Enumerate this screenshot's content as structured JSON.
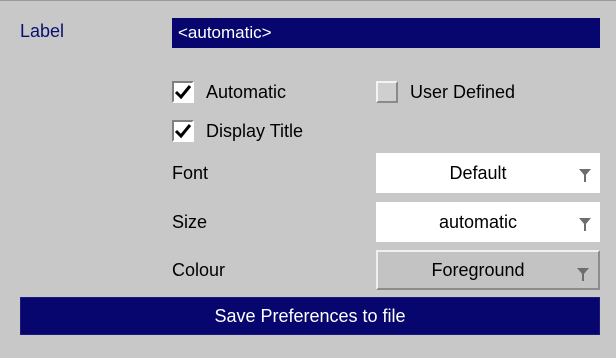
{
  "label": {
    "caption": "Label",
    "value": "<automatic>"
  },
  "checkboxes": {
    "automatic": {
      "label": "Automatic",
      "checked": true
    },
    "user_defined": {
      "label": "User Defined",
      "checked": false
    },
    "display_title": {
      "label": "Display Title",
      "checked": true
    }
  },
  "font": {
    "label": "Font",
    "value": "Default"
  },
  "size": {
    "label": "Size",
    "value": "automatic"
  },
  "colour": {
    "label": "Colour",
    "value": "Foreground"
  },
  "save_button": {
    "label": "Save Preferences to file"
  },
  "colors": {
    "panel_bg": "#c8c8c8",
    "selection_blue": "#06066e",
    "caption_blue": "#0b1070"
  }
}
